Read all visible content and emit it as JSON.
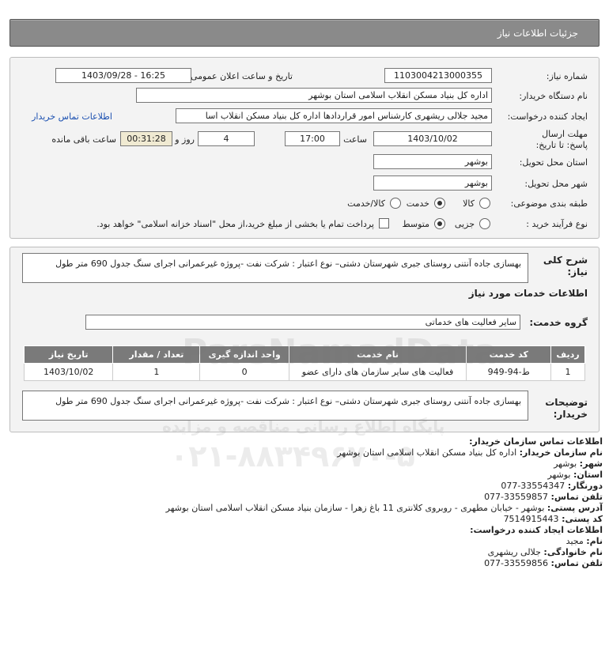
{
  "header": {
    "title": "جزئیات اطلاعات نیاز"
  },
  "form": {
    "need_number_label": "شماره نیاز:",
    "need_number": "1103004213000355",
    "announce_label": "تاریخ و ساعت اعلان عمومی:",
    "announce_value": "1403/09/28 - 16:25",
    "buyer_org_label": "نام دستگاه خریدار:",
    "buyer_org": "اداره کل بنیاد مسکن انقلاب اسلامی استان بوشهر",
    "creator_label": "ایجاد کننده درخواست:",
    "creator": "مجید جلالی ریشهری کارشناس امور قراردادها اداره کل بنیاد مسکن انقلاب اسا",
    "contact_link": "اطلاعات تماس خریدار",
    "deadline_label": "مهلت ارسال پاسخ: تا تاریخ:",
    "deadline_date": "1403/10/02",
    "time_label": "ساعت",
    "deadline_time": "17:00",
    "days_value": "4",
    "days_label": "روز و",
    "remaining_time": "00:31:28",
    "remaining_label": "ساعت باقی مانده",
    "province_label": "استان محل تحویل:",
    "province": "بوشهر",
    "city_label": "شهر محل تحویل:",
    "city": "بوشهر",
    "category_label": "طبقه بندی موضوعی:",
    "category_options": [
      "کالا",
      "خدمت",
      "کالا/خدمت"
    ],
    "category_selected": "خدمت",
    "process_label": "نوع فرآیند خرید :",
    "process_options": [
      "جزیی",
      "متوسط"
    ],
    "process_selected": "متوسط",
    "payment_note": "پرداخت تمام یا بخشی از مبلغ خرید،از محل \"اسناد خزانه اسلامی\" خواهد بود."
  },
  "summary": {
    "label": "شرح کلی نیاز:",
    "text": "بهسازی جاده آنتنی روستای جبری شهرستان دشتی– نوع اعتبار : شرکت نفت -پروژه غیرعمرانی اجرای سنگ جدول 690 متر طول"
  },
  "services": {
    "section_title": "اطلاعات خدمات مورد نیاز",
    "group_label": "گروه خدمت:",
    "group_value": "سایر فعالیت های خدماتی",
    "columns": [
      "ردیف",
      "کد خدمت",
      "نام خدمت",
      "واحد اندازه گیری",
      "تعداد / مقدار",
      "تاریخ نیاز"
    ],
    "rows": [
      [
        "1",
        "ط-94-949",
        "فعالیت های سایر سازمان های دارای عضو",
        "0",
        "1",
        "1403/10/02"
      ]
    ]
  },
  "buyer_notes": {
    "label": "توضیحات خریدار:",
    "text": "بهسازی جاده آنتنی روستای جبری شهرستان دشتی– نوع اعتبار : شرکت نفت -پروژه غیرعمرانی اجرای سنگ جدول 690 متر طول"
  },
  "contact": {
    "title": "اطلاعات تماس سازمان خریدار:",
    "org_label": "نام سازمان خریدار:",
    "org": "اداره کل بنیاد مسکن انقلاب اسلامی استان بوشهر",
    "city_label": "شهر:",
    "city": "بوشهر",
    "province_label": "استان:",
    "province": "بوشهر",
    "fax_label": "دورنگار:",
    "fax": "077-33554347",
    "phone_label": "تلفن تماس:",
    "phone": "077-33559857",
    "address_label": "آدرس پستی:",
    "address": "بوشهر - خیابان مطهری - روبروی کلانتری 11 باغ زهرا - سازمان بنیاد مسکن انقلاب اسلامی استان بوشهر",
    "postal_label": "کد پستی:",
    "postal": "7514915443",
    "creator_title": "اطلاعات ایجاد کننده درخواست:",
    "name_label": "نام:",
    "name": "مجید",
    "family_label": "نام خانوادگی:",
    "family": "جلالی ریشهری",
    "creator_phone_label": "تلفن تماس:",
    "creator_phone": "077-33559856"
  },
  "watermark": {
    "brand": "ParsNamadData",
    "tagline": "پایگاه اطلاع رسانی مناقصه و مزایده",
    "phone": "۰۲۱-۸۸۳۴۹۶۷۰-۵"
  }
}
